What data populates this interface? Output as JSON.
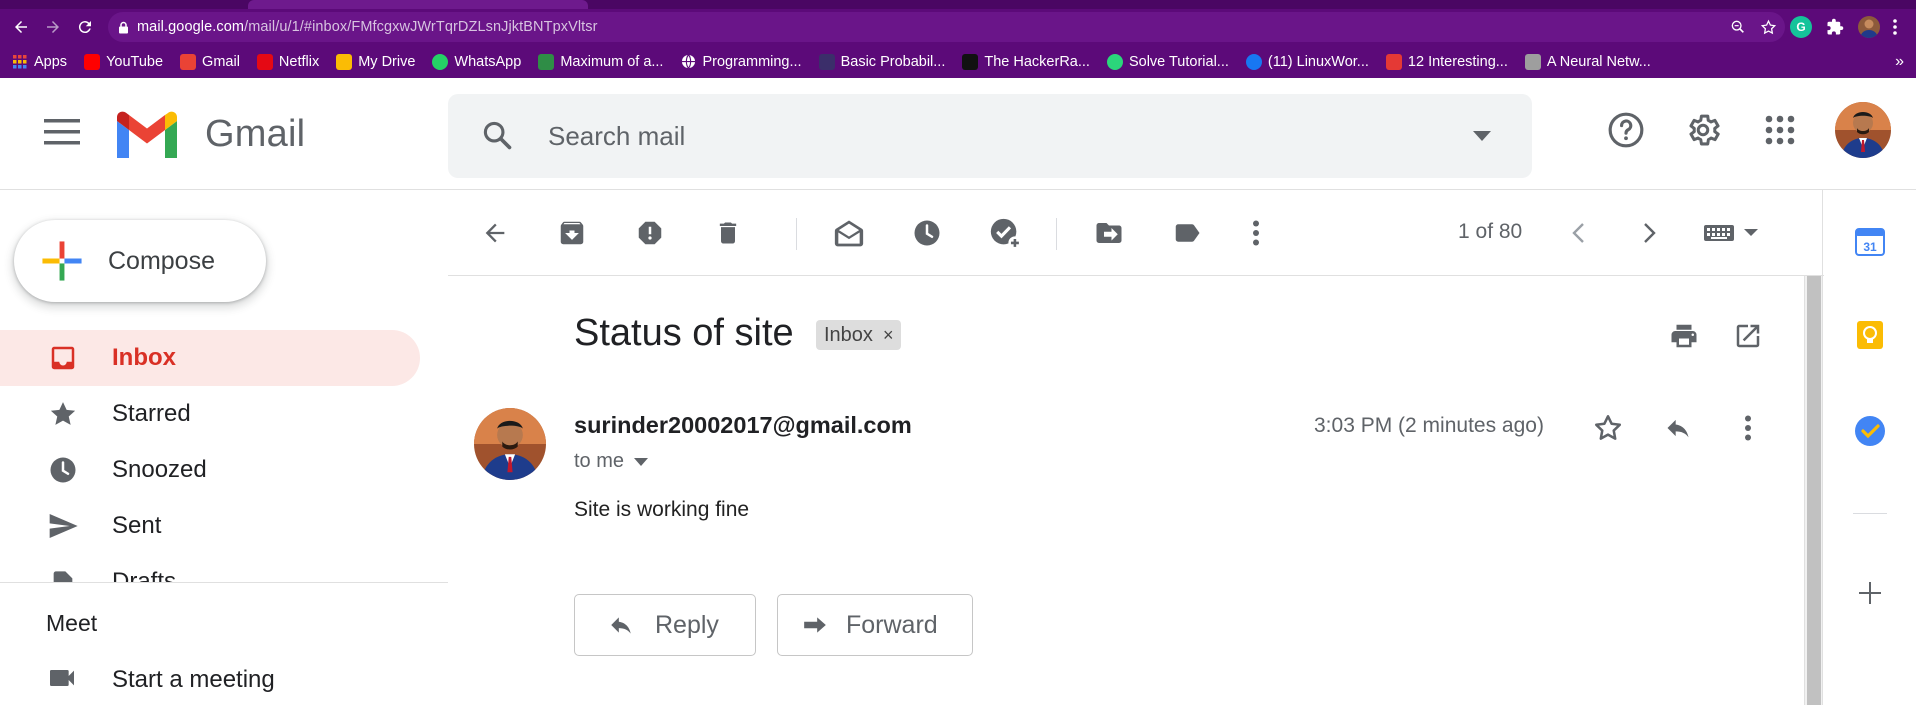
{
  "browser": {
    "url_host": "mail.google.com",
    "url_path": "/mail/u/1/#inbox/FMfcgxwJWrTqrDZLsnJjktBNTpxVltsr",
    "bookmarks": [
      {
        "label": "Apps",
        "icon": "apps-grid-icon",
        "color": "#e8453c"
      },
      {
        "label": "YouTube",
        "icon": "youtube-icon",
        "color": "#ff0000"
      },
      {
        "label": "Gmail",
        "icon": "gmail-icon",
        "color": "#ea4335"
      },
      {
        "label": "Netflix",
        "icon": "netflix-icon",
        "color": "#e50914"
      },
      {
        "label": "My Drive",
        "icon": "drive-icon",
        "color": "#fbbc04"
      },
      {
        "label": "WhatsApp",
        "icon": "whatsapp-icon",
        "color": "#25d366"
      },
      {
        "label": "Maximum of a...",
        "icon": "gfg-icon",
        "color": "#2f8d46"
      },
      {
        "label": "Programming...",
        "icon": "globe-icon",
        "color": "#ffffff"
      },
      {
        "label": "Basic Probabil...",
        "icon": "site-icon",
        "color": "#3b2e6a"
      },
      {
        "label": "The HackerRa...",
        "icon": "hackerrank-icon",
        "color": "#111111"
      },
      {
        "label": "Solve Tutorial...",
        "icon": "hackerearth-icon",
        "color": "#2bd67b"
      },
      {
        "label": "(11) LinuxWor...",
        "icon": "facebook-icon",
        "color": "#1877f2"
      },
      {
        "label": "12 Interesting...",
        "icon": "article-icon",
        "color": "#e53935"
      },
      {
        "label": "A Neural Netw...",
        "icon": "page-icon",
        "color": "#9e9e9e"
      }
    ],
    "bookmarks_more": "»"
  },
  "header": {
    "logo_text": "Gmail",
    "search_placeholder": "Search mail"
  },
  "nav": {
    "compose_label": "Compose",
    "items": [
      {
        "label": "Inbox",
        "icon": "inbox-icon",
        "active": true
      },
      {
        "label": "Starred",
        "icon": "star-icon"
      },
      {
        "label": "Snoozed",
        "icon": "clock-icon"
      },
      {
        "label": "Sent",
        "icon": "send-icon"
      },
      {
        "label": "Drafts",
        "icon": "draft-icon"
      }
    ],
    "meet_title": "Meet",
    "meet_item": "Start a meeting"
  },
  "toolbar": {
    "pager_text": "1 of 80"
  },
  "message": {
    "subject": "Status of site",
    "label_chip": "Inbox",
    "label_chip_remove": "×",
    "sender": "surinder20002017@gmail.com",
    "recipient": "to me",
    "time": "3:03 PM (2 minutes ago)",
    "body": "Site is working fine",
    "reply_label": "Reply",
    "forward_label": "Forward"
  },
  "colors": {
    "chrome_theme": "#5c0a79",
    "active_nav_bg": "#fce8e6",
    "active_nav_text": "#d93025"
  }
}
